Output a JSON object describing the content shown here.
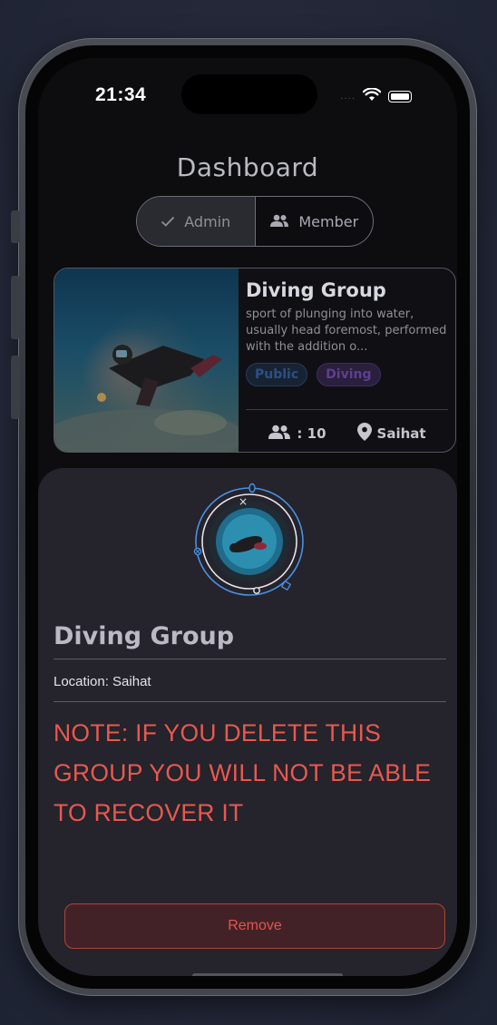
{
  "status_bar": {
    "time": "21:34",
    "dots": "....",
    "icons": [
      "wifi-icon",
      "battery-icon"
    ]
  },
  "header": {
    "title": "Dashboard"
  },
  "segmented": {
    "options": [
      {
        "label": "Admin",
        "icon": "check-icon",
        "selected": true
      },
      {
        "label": "Member",
        "icon": "people-icon",
        "selected": false
      }
    ]
  },
  "group_card": {
    "title": "Diving Group",
    "description": "sport of plunging into water, usually head foremost, performed with the addition o...",
    "tags": [
      {
        "label": "Public",
        "color": "#2c4f86"
      },
      {
        "label": "Diving",
        "color": "#5e3f8f"
      }
    ],
    "members_text": ": 10",
    "location": "Saihat"
  },
  "sheet": {
    "title": "Diving Group",
    "location_text": "Location: Saihat",
    "note": "NOTE: IF YOU DELETE THIS GROUP YOU WILL NOT BE ABLE TO RECOVER IT",
    "remove_label": "Remove"
  },
  "colors": {
    "accent_red": "#e8594f",
    "sheet_bg": "#25232b",
    "selection_ring": "#4a90e2"
  }
}
